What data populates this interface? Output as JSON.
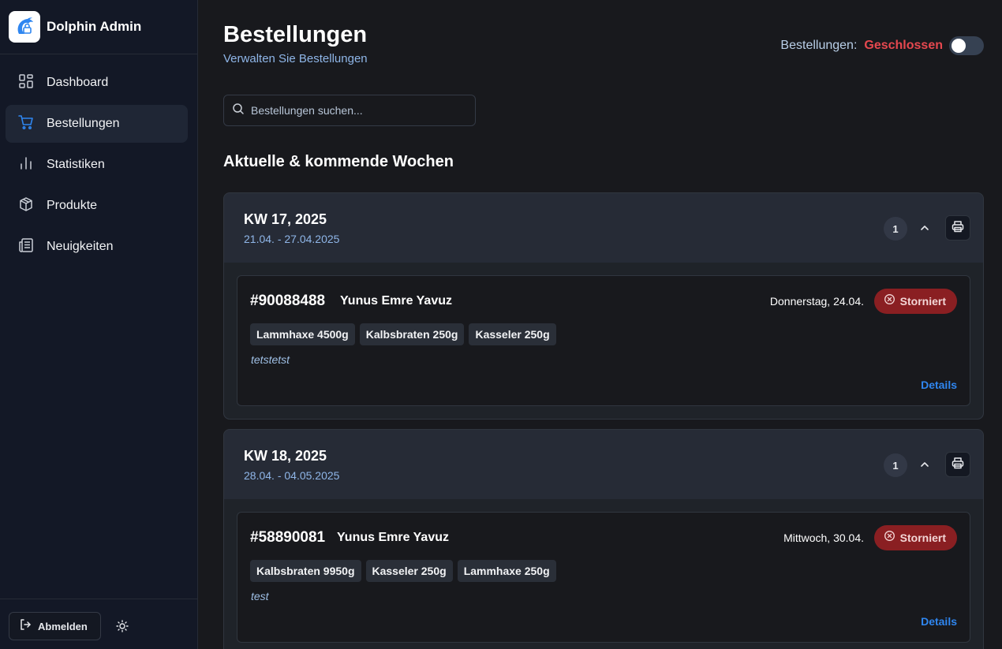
{
  "sidebar": {
    "app_name": "Dolphin Admin",
    "items": [
      {
        "label": "Dashboard",
        "icon": "layout-grid-icon",
        "active": false
      },
      {
        "label": "Bestellungen",
        "icon": "shopping-cart-icon",
        "active": true
      },
      {
        "label": "Statistiken",
        "icon": "bar-chart-icon",
        "active": false
      },
      {
        "label": "Produkte",
        "icon": "package-icon",
        "active": false
      },
      {
        "label": "Neuigkeiten",
        "icon": "newspaper-icon",
        "active": false
      }
    ],
    "logout_label": "Abmelden",
    "theme_icon": "sun-icon"
  },
  "header": {
    "title": "Bestellungen",
    "subtitle": "Verwalten Sie Bestellungen",
    "status_label": "Bestellungen:",
    "status_value": "Geschlossen",
    "toggle_on": false
  },
  "search": {
    "placeholder": "Bestellungen suchen..."
  },
  "section": {
    "title": "Aktuelle & kommende Wochen"
  },
  "weeks": [
    {
      "title": "KW 17, 2025",
      "range": "21.04. - 27.04.2025",
      "count": "1",
      "orders": [
        {
          "id": "#90088488",
          "customer": "Yunus Emre Yavuz",
          "date": "Donnerstag, 24.04.",
          "status": "Storniert",
          "items": [
            "Lammhaxe 4500g",
            "Kalbsbraten 250g",
            "Kasseler 250g"
          ],
          "note": "tetstetst",
          "details_label": "Details"
        }
      ]
    },
    {
      "title": "KW 18, 2025",
      "range": "28.04. - 04.05.2025",
      "count": "1",
      "orders": [
        {
          "id": "#58890081",
          "customer": "Yunus Emre Yavuz",
          "date": "Mittwoch, 30.04.",
          "status": "Storniert",
          "items": [
            "Kalbsbraten 9950g",
            "Kasseler 250g",
            "Lammhaxe 250g"
          ],
          "note": "test",
          "details_label": "Details"
        }
      ]
    }
  ],
  "colors": {
    "accent": "#2f86f0",
    "closed": "#e6484f",
    "cancelled_badge": "#8a1f22"
  }
}
